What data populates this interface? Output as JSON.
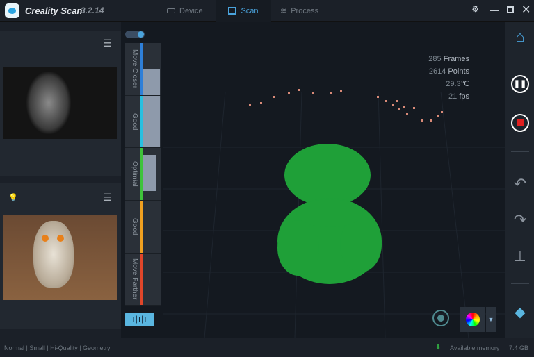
{
  "app": {
    "name": "Creality Scan",
    "version": "3.2.14"
  },
  "tabs": [
    {
      "label": "Device",
      "icon": "device-icon"
    },
    {
      "label": "Scan",
      "icon": "scan-icon",
      "active": true
    },
    {
      "label": "Process",
      "icon": "layers-icon"
    }
  ],
  "window_controls": [
    "settings-icon",
    "minimize-icon",
    "maximize-icon",
    "close-icon"
  ],
  "distance": {
    "zones": [
      "Move Closer",
      "Good",
      "Optimial",
      "Good",
      "Move Farther"
    ],
    "colors": [
      "#2e7fd8",
      "#27c0e0",
      "#3ec33a",
      "#f0a020",
      "#e0462a"
    ]
  },
  "stats": {
    "frames": "285",
    "frames_label": "Frames",
    "points": "2614",
    "points_label": "Points",
    "temp": "29.3",
    "temp_unit": "℃",
    "fps": "21",
    "fps_label": "fps"
  },
  "status": {
    "mode": "Normal | Small | Hi-Quality | Geometry",
    "memory_label": "Available memory",
    "memory_value": "7.4 GB"
  },
  "colors": {
    "accent": "#4aa3dc",
    "cloud": "#1fa038",
    "record": "#e02020"
  }
}
